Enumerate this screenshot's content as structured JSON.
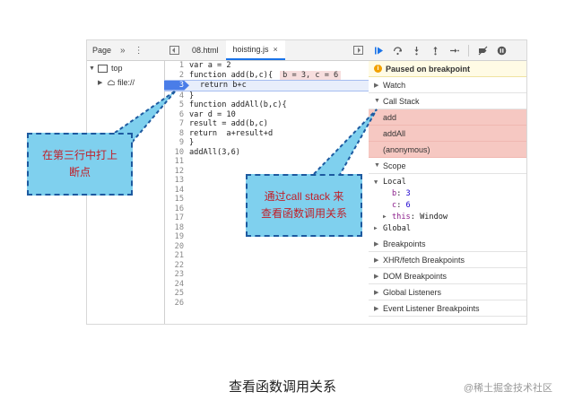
{
  "navigator": {
    "tab_label": "Page",
    "more_glyph": "»",
    "menu_glyph": "⋮",
    "tree": [
      {
        "label": "top",
        "expanded": true,
        "icon": "frame-icon"
      },
      {
        "label": "file://",
        "expanded": false,
        "icon": "cloud-icon"
      }
    ]
  },
  "editor": {
    "tabs": [
      {
        "label": "08.html",
        "active": false
      },
      {
        "label": "hoisting.js",
        "active": true,
        "close": "×"
      }
    ],
    "lines": [
      {
        "n": "1",
        "text": "var a = 2"
      },
      {
        "n": "2",
        "text": "function add(b,c){",
        "inline": "b = 3, c = 6"
      },
      {
        "n": "3",
        "text": "return b+c",
        "breakpoint": true
      },
      {
        "n": "4",
        "text": "}"
      },
      {
        "n": "5",
        "text": "function addAll(b,c){"
      },
      {
        "n": "6",
        "text": "var d = 10"
      },
      {
        "n": "7",
        "text": "result = add(b,c)"
      },
      {
        "n": "8",
        "text": "return  a+result+d"
      },
      {
        "n": "9",
        "text": "}"
      },
      {
        "n": "10",
        "text": "addAll(3,6)"
      },
      {
        "n": "11",
        "text": ""
      },
      {
        "n": "12",
        "text": ""
      },
      {
        "n": "13",
        "text": ""
      },
      {
        "n": "14",
        "text": ""
      },
      {
        "n": "15",
        "text": ""
      },
      {
        "n": "16",
        "text": ""
      },
      {
        "n": "17",
        "text": ""
      },
      {
        "n": "18",
        "text": ""
      },
      {
        "n": "19",
        "text": ""
      },
      {
        "n": "20",
        "text": ""
      },
      {
        "n": "21",
        "text": ""
      },
      {
        "n": "22",
        "text": ""
      },
      {
        "n": "23",
        "text": ""
      },
      {
        "n": "24",
        "text": ""
      },
      {
        "n": "25",
        "text": ""
      },
      {
        "n": "26",
        "text": ""
      }
    ]
  },
  "debugger": {
    "toolbar_icons": [
      "resume-icon",
      "step-over-icon",
      "step-into-icon",
      "step-out-icon",
      "step-icon",
      "deactivate-breakpoints-icon",
      "pause-on-exceptions-icon"
    ],
    "paused_text": "Paused on breakpoint",
    "watch_label": "Watch",
    "call_stack_label": "Call Stack",
    "call_stack": [
      "add",
      "addAll",
      "(anonymous)"
    ],
    "scope_label": "Scope",
    "local_label": "Local",
    "locals": [
      {
        "key": "b",
        "value": "3"
      },
      {
        "key": "c",
        "value": "6"
      }
    ],
    "this_label": "this",
    "this_value": "Window",
    "global_label": "Global",
    "sections": [
      "Breakpoints",
      "XHR/fetch Breakpoints",
      "DOM Breakpoints",
      "Global Listeners",
      "Event Listener Breakpoints"
    ]
  },
  "annotations": {
    "left_note": "在第三行中打上\n断点",
    "right_note": "通过call stack 来\n查看函数调用关系"
  },
  "caption": "查看函数调用关系",
  "watermark": "@稀土掘金技术社区",
  "colors": {
    "call_stack_bg": "#f6c8c2",
    "note_bg": "#7fd0ee",
    "note_border": "#1d5aa0",
    "note_text": "#c0202a",
    "breakpoint": "#4a7de8"
  }
}
